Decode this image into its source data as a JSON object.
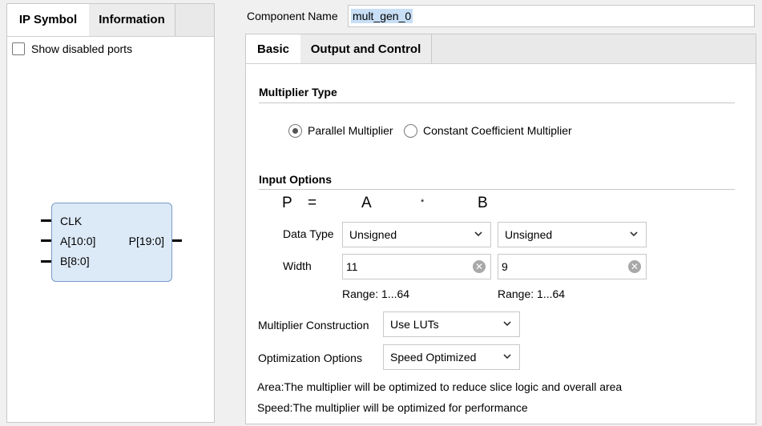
{
  "left_panel": {
    "tabs": [
      {
        "label": "IP Symbol",
        "active": true
      },
      {
        "label": "Information",
        "active": false
      }
    ],
    "show_disabled_ports": {
      "label": "Show disabled ports",
      "checked": false
    },
    "symbol": {
      "left_ports": [
        "CLK",
        "A[10:0]",
        "B[8:0]"
      ],
      "right_ports": [
        "P[19:0]"
      ]
    }
  },
  "component_name": {
    "label": "Component Name",
    "value": "mult_gen_0"
  },
  "right_panel": {
    "tabs": [
      {
        "label": "Basic",
        "active": true
      },
      {
        "label": "Output and Control",
        "active": false
      }
    ],
    "multiplier_type": {
      "title": "Multiplier Type",
      "options": [
        {
          "label": "Parallel Multiplier",
          "selected": true
        },
        {
          "label": "Constant Coefficient Multiplier",
          "selected": false
        }
      ]
    },
    "input_options": {
      "title": "Input Options",
      "equation": {
        "p": "P",
        "eq": "=",
        "a": "A",
        "op": "*",
        "b": "B"
      },
      "data_type_label": "Data Type",
      "width_label": "Width",
      "a": {
        "data_type": "Unsigned",
        "width": "11",
        "range": "Range: 1...64"
      },
      "b": {
        "data_type": "Unsigned",
        "width": "9",
        "range": "Range: 1...64"
      }
    },
    "construction": {
      "label": "Multiplier Construction",
      "value": "Use LUTs"
    },
    "optimization": {
      "label": "Optimization Options",
      "value": "Speed Optimized"
    },
    "notes": {
      "area": "Area:The multiplier will be optimized to reduce slice logic and overall area",
      "speed": "Speed:The multiplier will be optimized for performance"
    }
  },
  "colors": {
    "symbol_fill": "#dce9f7",
    "symbol_border": "#7a9cc6",
    "selection_highlight": "#c7def5"
  }
}
